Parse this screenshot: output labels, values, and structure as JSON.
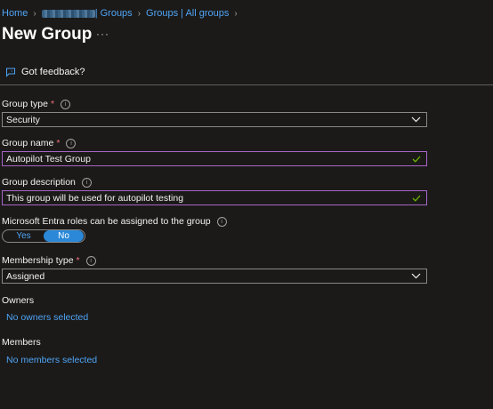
{
  "breadcrumb": {
    "home": "Home",
    "redacted": "",
    "groups": "| Groups",
    "all_groups": "Groups | All groups"
  },
  "page": {
    "title": "New Group",
    "more": "···"
  },
  "feedback": {
    "label": "Got feedback?"
  },
  "form": {
    "group_type": {
      "label": "Group type",
      "required_mark": "*",
      "value": "Security"
    },
    "group_name": {
      "label": "Group name",
      "required_mark": "*",
      "value": "Autopilot Test Group"
    },
    "group_description": {
      "label": "Group description",
      "value": "This group will be used for autopilot testing"
    },
    "entra_roles": {
      "label": "Microsoft Entra roles can be assigned to the group",
      "yes": "Yes",
      "no": "No",
      "selected": "No"
    },
    "membership_type": {
      "label": "Membership type",
      "required_mark": "*",
      "value": "Assigned"
    },
    "owners": {
      "label": "Owners",
      "link": "No owners selected"
    },
    "members": {
      "label": "Members",
      "link": "No members selected"
    }
  },
  "colors": {
    "background": "#1b1a19",
    "link": "#4fa4f5",
    "accent": "#2b88d8",
    "valid_border": "#a865c8",
    "check": "#6bb700",
    "required": "#f1707b"
  },
  "icons": [
    "feedback-icon",
    "info-icon",
    "chevron-down-icon",
    "checkmark-icon",
    "chevron-right-icon"
  ]
}
